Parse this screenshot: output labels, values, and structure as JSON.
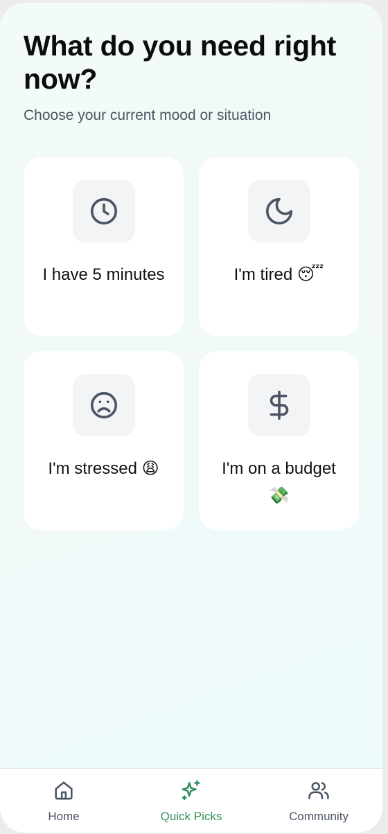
{
  "header": {
    "title": "What do you need right now?",
    "subtitle": "Choose your current mood or situation"
  },
  "options": [
    {
      "label": "I have 5 minutes",
      "icon": "clock-icon"
    },
    {
      "label": "I'm tired 😴",
      "icon": "moon-icon"
    },
    {
      "label": "I'm stressed 😩",
      "icon": "frown-icon"
    },
    {
      "label": "I'm on a budget 💸",
      "icon": "dollar-icon"
    }
  ],
  "tabs": [
    {
      "label": "Home",
      "icon": "home-icon",
      "active": false
    },
    {
      "label": "Quick Picks",
      "icon": "sparkles-icon",
      "active": true
    },
    {
      "label": "Community",
      "icon": "users-icon",
      "active": false
    }
  ],
  "colors": {
    "accent": "#2f8f5b",
    "icon": "#4b5563",
    "card": "#ffffff",
    "icon_bg": "#f3f4f6"
  }
}
